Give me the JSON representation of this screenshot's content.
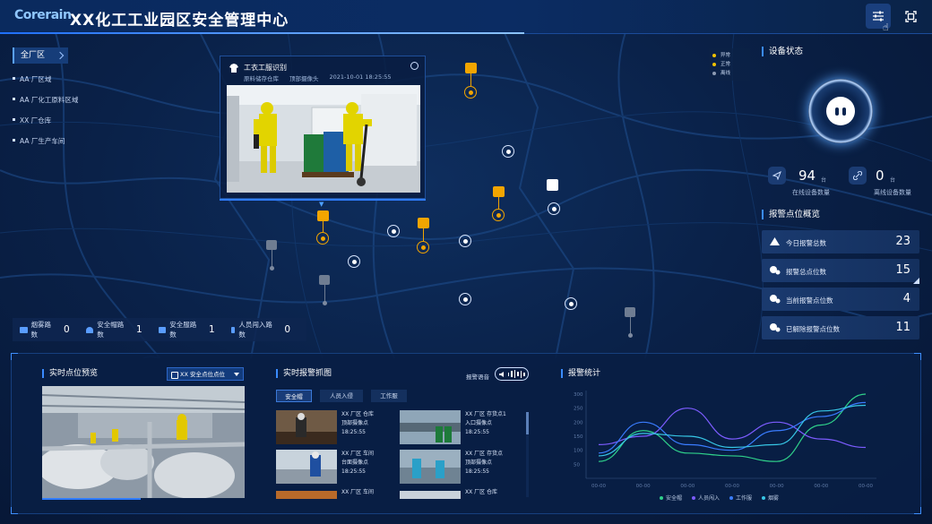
{
  "header": {
    "logo": "Corerain",
    "title": "XX化工工业园区安全管理中心"
  },
  "regions": {
    "selected": "全厂区",
    "items": [
      "AA 厂区域",
      "AA 厂化工原料区域",
      "XX 厂仓库",
      "AA 厂生产车间"
    ]
  },
  "popup": {
    "title": "工衣工服识别",
    "location": "原料储存仓库",
    "camera": "顶部摄像头",
    "time": "2021-10-01 18:25:55"
  },
  "legend": [
    {
      "label": "异常",
      "color": "#f2c200"
    },
    {
      "label": "正常",
      "color": "#f2c200"
    },
    {
      "label": "离线",
      "color": "#8d9bb3"
    }
  ],
  "device_status": {
    "title": "设备状态",
    "online_count": "94",
    "online_unit": "台",
    "online_label": "在线设备数量",
    "offline_count": "0",
    "offline_unit": "台",
    "offline_label": "离线设备数量"
  },
  "alarm_overview": {
    "title": "报警点位概览",
    "rows": [
      {
        "label": "今日报警总数",
        "value": "23"
      },
      {
        "label": "报警总点位数",
        "value": "15"
      },
      {
        "label": "当前报警点位数",
        "value": "4"
      },
      {
        "label": "已解除报警点位数",
        "value": "11"
      }
    ]
  },
  "counters": [
    {
      "label": "烟雾路数",
      "value": "0",
      "icon": "smoke-icon"
    },
    {
      "label": "安全帽路数",
      "value": "1",
      "icon": "helmet-icon"
    },
    {
      "label": "安全服路数",
      "value": "1",
      "icon": "suit-icon"
    },
    {
      "label": "人员闯入路数",
      "value": "0",
      "icon": "person-icon"
    }
  ],
  "preview": {
    "title": "实时点位预览",
    "select_value": "XX 安全点位点位"
  },
  "capture": {
    "title": "实时报警抓图",
    "voice_label": "报警语音",
    "tabs": [
      "安全帽",
      "人员入侵",
      "工作服"
    ],
    "items": [
      {
        "l1": "XX 厂区 仓库",
        "l2": "顶部摄像点",
        "l3": "18:25:55"
      },
      {
        "l1": "XX 厂区 存货点1",
        "l2": "入口摄像点",
        "l3": "18:25:55"
      },
      {
        "l1": "XX 厂区 车间",
        "l2": "台面摄像点",
        "l3": "18:25:55"
      },
      {
        "l1": "XX 厂区 存货点",
        "l2": "顶部摄像点",
        "l3": "18:25:55"
      },
      {
        "l1": "XX 厂区 车间",
        "l2": "",
        "l3": ""
      },
      {
        "l1": "XX 厂区 仓库",
        "l2": "",
        "l3": ""
      }
    ]
  },
  "chart_data": {
    "type": "line",
    "title": "报警统计",
    "x": [
      "00-00",
      "00-00",
      "00-00",
      "00-00",
      "00-00",
      "00-00",
      "00-00"
    ],
    "ylim": [
      0,
      300
    ],
    "yticks": [
      "300",
      "250",
      "200",
      "150",
      "100",
      "50"
    ],
    "series": [
      {
        "name": "安全帽",
        "color": "#2fd08a",
        "values": [
          60,
          170,
          90,
          80,
          60,
          190,
          300
        ]
      },
      {
        "name": "人员闯入",
        "color": "#7c5cff",
        "values": [
          120,
          150,
          250,
          140,
          200,
          140,
          110
        ]
      },
      {
        "name": "工作服",
        "color": "#3a7cff",
        "values": [
          90,
          200,
          120,
          100,
          170,
          220,
          270
        ]
      },
      {
        "name": "烟雾",
        "color": "#37c7e6",
        "values": [
          80,
          160,
          150,
          110,
          120,
          240,
          260
        ]
      }
    ],
    "legend_position": "bottom"
  }
}
